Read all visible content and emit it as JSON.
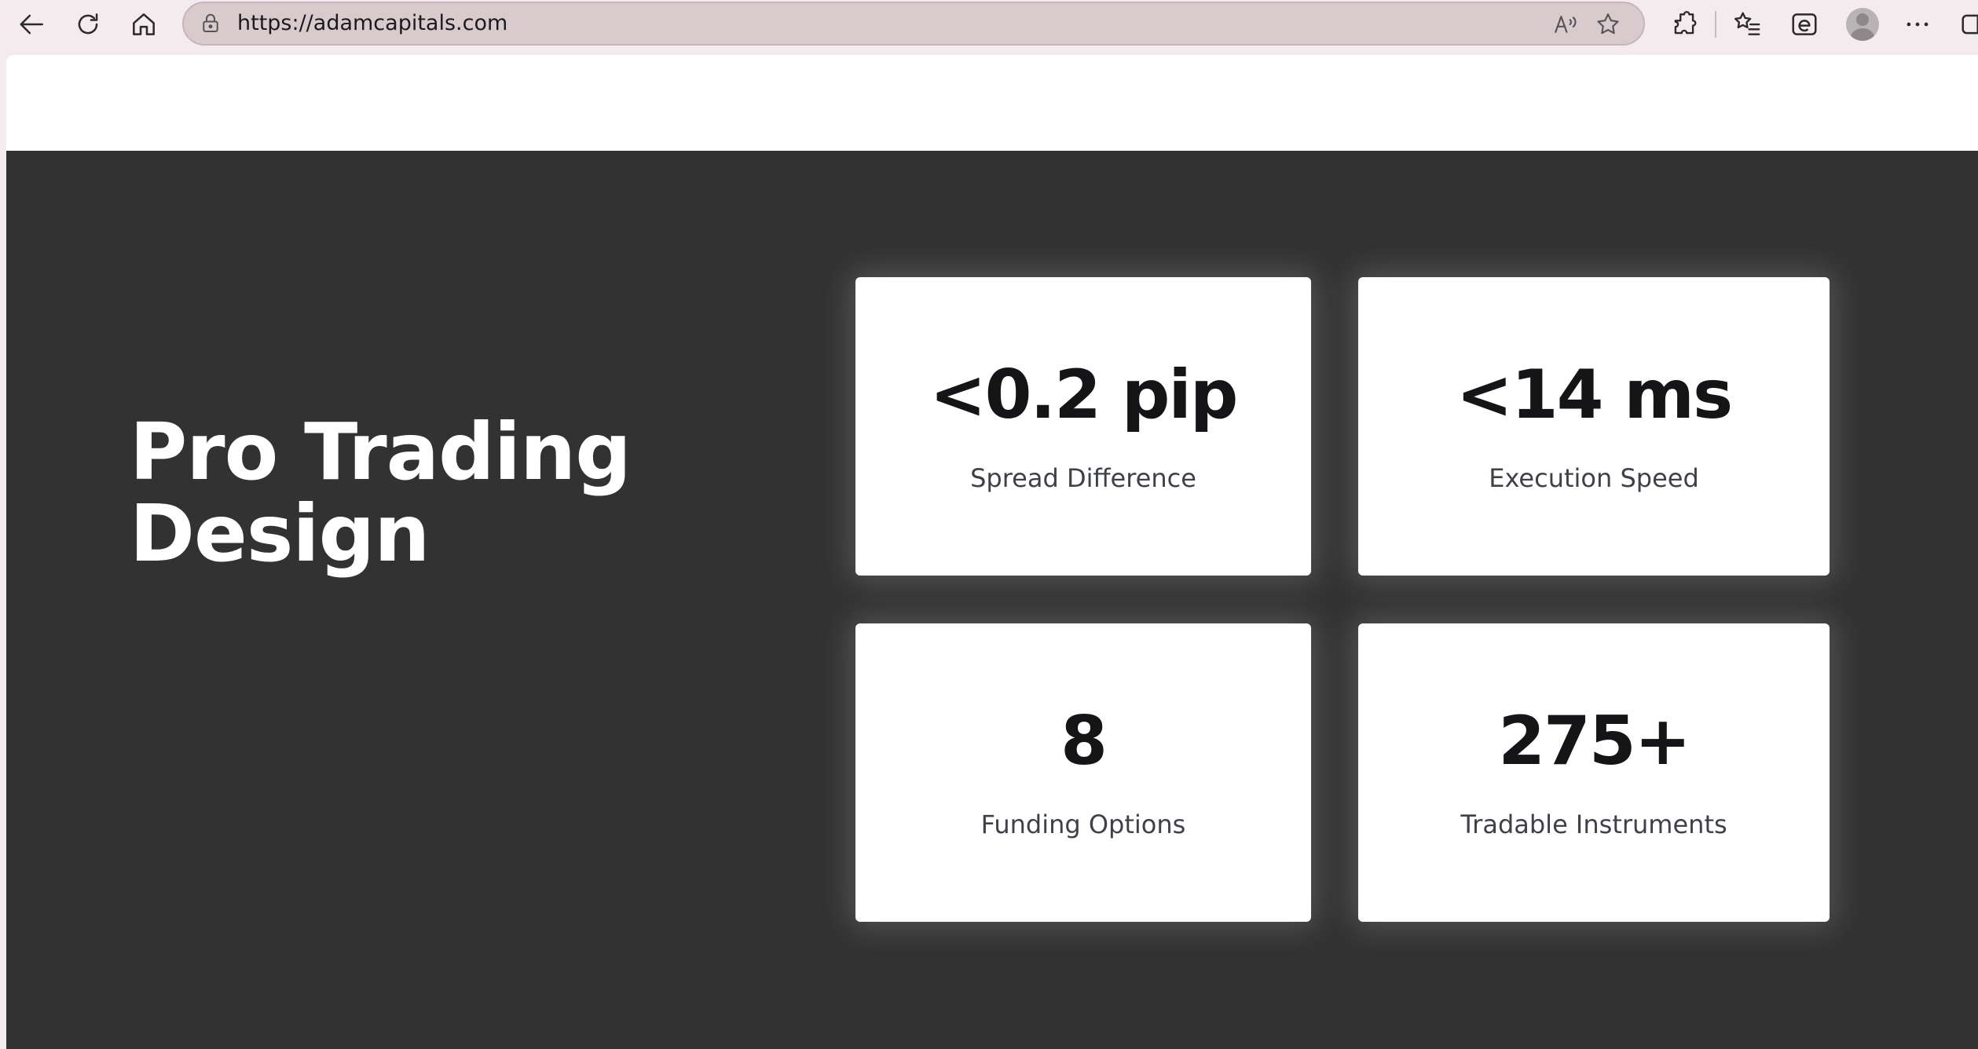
{
  "browser": {
    "url": "https://adamcapitals.com",
    "icons": {
      "back": "back-arrow-icon",
      "refresh": "refresh-icon",
      "home": "home-icon",
      "lock": "lock-icon",
      "read_aloud": "read-aloud-icon",
      "favorite": "star-icon",
      "extensions": "puzzle-icon",
      "favorites": "favorites-list-icon",
      "ie_mode": "ie-mode-icon",
      "profile": "profile-avatar-icon",
      "more": "more-dots-icon",
      "sidebar": "sidebar-icon"
    }
  },
  "page": {
    "hero_title_line1": "Pro Trading",
    "hero_title_line2": "Design",
    "stats": [
      {
        "value": "<0.2 pip",
        "label": "Spread Difference"
      },
      {
        "value": "<14 ms",
        "label": "Execution Speed"
      },
      {
        "value": "8",
        "label": "Funding Options"
      },
      {
        "value": "275+",
        "label": "Tradable Instruments"
      }
    ]
  },
  "colors": {
    "chrome_bg": "#f3ebee",
    "section_bg": "#323232",
    "card_bg": "#ffffff",
    "value_text": "#151518",
    "label_text": "#3f4148"
  }
}
